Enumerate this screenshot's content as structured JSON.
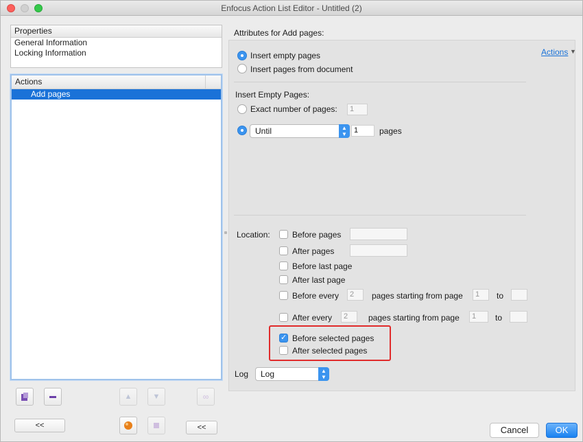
{
  "window": {
    "title": "Enfocus Action List Editor - Untitled (2)"
  },
  "properties": {
    "header": "Properties",
    "items": [
      "General Information",
      "Locking Information"
    ]
  },
  "actions_list": {
    "header": "Actions",
    "items": [
      "Add pages"
    ]
  },
  "left_buttons": {
    "collapse_left": "<<",
    "collapse_right": "<<"
  },
  "attributes": {
    "title": "Attributes for Add pages:",
    "actions_link": "Actions",
    "insert_empty": "Insert empty pages",
    "insert_from_doc": "Insert pages from document",
    "empty_section_title": "Insert Empty Pages:",
    "exact_number_label": "Exact number of pages:",
    "exact_number_value": "1",
    "until_select": "Until",
    "until_value": "1",
    "until_suffix": "pages",
    "location_label": "Location:",
    "before_pages": "Before pages",
    "after_pages": "After pages",
    "before_last_page": "Before last page",
    "after_last_page": "After last page",
    "before_every": "Before every",
    "before_every_value": "2",
    "before_every_suffix": "pages starting from page",
    "before_every_start": "1",
    "to_label": "to",
    "after_every": "After every",
    "after_every_value": "2",
    "after_every_suffix": "pages starting from page",
    "after_every_start": "1",
    "before_selected": "Before selected pages",
    "after_selected": "After selected pages",
    "log_label": "Log",
    "log_select": "Log"
  },
  "footer": {
    "cancel": "Cancel",
    "ok": "OK"
  },
  "colors": {
    "accent": "#3b94ef",
    "selection": "#1a72d8",
    "highlight_box": "#e02b2b"
  }
}
